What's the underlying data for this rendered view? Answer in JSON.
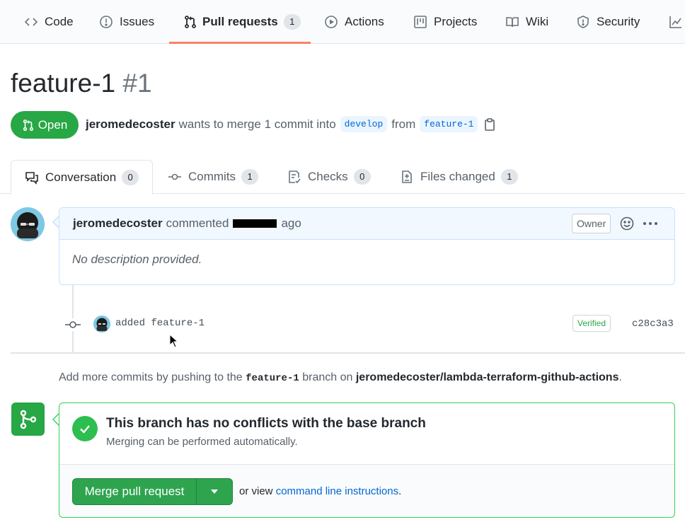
{
  "repo_nav": {
    "items": [
      {
        "label": "Code",
        "icon": "code-icon"
      },
      {
        "label": "Issues",
        "icon": "issue-icon"
      },
      {
        "label": "Pull requests",
        "icon": "pull-request-icon",
        "count": "1",
        "selected": true
      },
      {
        "label": "Actions",
        "icon": "play-icon"
      },
      {
        "label": "Projects",
        "icon": "project-icon"
      },
      {
        "label": "Wiki",
        "icon": "book-icon"
      },
      {
        "label": "Security",
        "icon": "shield-icon"
      }
    ]
  },
  "pr": {
    "title": "feature-1",
    "number": "#1",
    "state": "Open",
    "author": "jeromedecoster",
    "merge_text": "wants to merge 1 commit into",
    "base_branch": "develop",
    "from_text": "from",
    "head_branch": "feature-1"
  },
  "tabs": [
    {
      "label": "Conversation",
      "count": "0",
      "icon": "comment-discussion-icon"
    },
    {
      "label": "Commits",
      "count": "1",
      "icon": "commit-icon"
    },
    {
      "label": "Checks",
      "count": "0",
      "icon": "checklist-icon"
    },
    {
      "label": "Files changed",
      "count": "1",
      "icon": "diff-icon"
    }
  ],
  "comment": {
    "author": "jeromedecoster",
    "action": "commented",
    "time_suffix": "ago",
    "role_label": "Owner",
    "body": "No description provided."
  },
  "commit": {
    "message": "added feature-1",
    "badge": "Verified",
    "sha": "c28c3a3"
  },
  "push_hint": {
    "prefix": "Add more commits by pushing to the",
    "branch": "feature-1",
    "middle": "branch on",
    "repo": "jeromedecoster/lambda-terraform-github-actions",
    "suffix": "."
  },
  "merge": {
    "title": "This branch has no conflicts with the base branch",
    "subtitle": "Merging can be performed automatically.",
    "button_label": "Merge pull request",
    "or_view": "or view",
    "link_text": "command line instructions",
    "link_suffix": "."
  },
  "colors": {
    "accent_green": "#28a745",
    "link_blue": "#0366d6",
    "nav_underline": "#f9826c"
  }
}
